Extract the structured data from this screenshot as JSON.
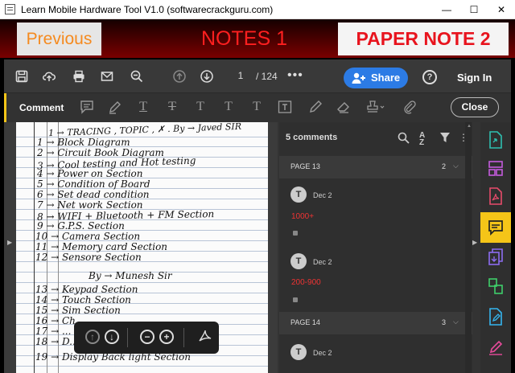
{
  "window": {
    "title": "Learn Mobile Hardware Tool V1.0 (softwarecrackguru.com)",
    "minimize": "—",
    "maximize": "☐",
    "close": "✕"
  },
  "header": {
    "previous_label": "Previous",
    "notes1_label": "NOTES 1",
    "paper_note_label": "PAPER NOTE 2"
  },
  "toolbar": {
    "current_page": "1",
    "total_pages": "/ 124",
    "more": "•••",
    "share_label": "Share",
    "help": "?",
    "sign_in_label": "Sign In"
  },
  "comment_bar": {
    "label": "Comment",
    "close_label": "Close"
  },
  "comments_panel": {
    "count_label": "5 comments",
    "groups": [
      {
        "page_label": "PAGE 13",
        "count": "2",
        "comments": [
          {
            "avatar": "T",
            "date": "Dec 2",
            "text": "1000+"
          },
          {
            "avatar": "T",
            "date": "Dec 2",
            "text": "200-900"
          }
        ]
      },
      {
        "page_label": "PAGE 14",
        "count": "3",
        "comments": [
          {
            "avatar": "T",
            "date": "Dec 2",
            "text": ""
          }
        ]
      }
    ]
  },
  "document": {
    "handwritten_lines": [
      "1 → TRACING , TOPIC , ✗ . By → Javed SIR",
      "1 → Block Diagram",
      "2 → Circuit Book Diagram",
      "3 → Cool testing and Hot testing",
      "4 → Power on Section",
      "5 → Condition of Board",
      "6 → Set dead condition",
      "7 → Net work Section",
      "8 → WIFI + Bluetooth + FM Section",
      "9 → G.P.S. Section",
      "10 → Camera Section",
      "11 → Memory card Section",
      "12 → Sensore Section",
      "By → Munesh Sir",
      "13 → Keypad Section",
      "14 → Touch Section",
      "15 → Sim Section",
      "16 → Ch...",
      "17 → ...",
      "18 → D...",
      "19 → Display Back light Section"
    ]
  },
  "colors": {
    "accent": "#f5c518",
    "share_blue": "#2c7be5",
    "previous_orange": "#f58a1f",
    "notes_red": "#ff1f1f",
    "comment_red": "#e33333"
  }
}
